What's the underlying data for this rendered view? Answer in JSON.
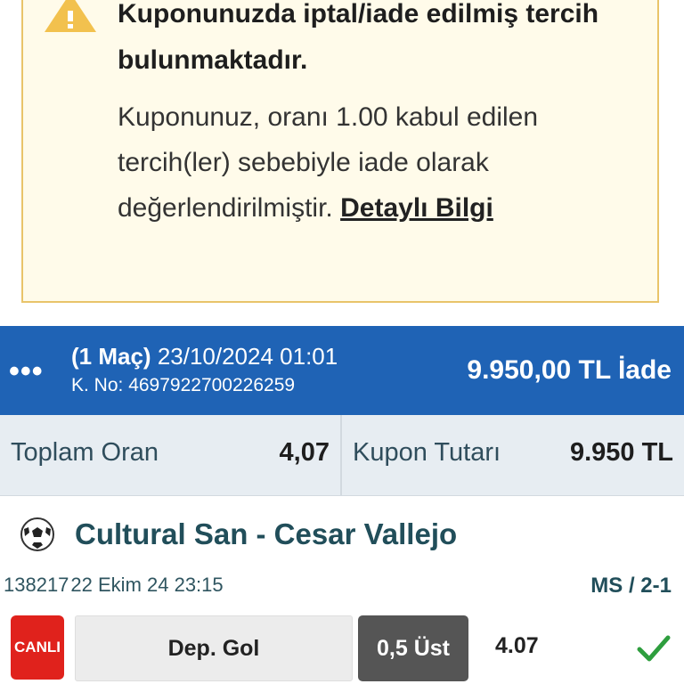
{
  "warning": {
    "title": "Kuponunuzda iptal/iade edilmiş tercih bulunmaktadır.",
    "body": "Kuponunuz, oranı 1.00 kabul edilen tercih(ler) sebebiyle iade olarak değerlendirilmiştir.",
    "link": "Detaylı Bilgi"
  },
  "coupon": {
    "menu": "•••",
    "match_count": "(1 Maç)",
    "datetime": "23/10/2024 01:01",
    "coupon_no": "K. No: 4697922700226259",
    "amount": "9.950,00 TL İade"
  },
  "summary": {
    "total_odds_label": "Toplam Oran",
    "total_odds_value": "4,07",
    "coupon_amount_label": "Kupon Tutarı",
    "coupon_amount_value": "9.950 TL"
  },
  "match": {
    "name": "Cultural San - Cesar Vallejo",
    "code": "138217",
    "date": "22 Ekim 24 23:15",
    "bet_type": "MS / 2-1",
    "live_label": "CANLI",
    "market": "Dep. Gol",
    "choice": "0,5 Üst",
    "odd": "4.07"
  },
  "colors": {
    "header_blue": "#1f63b5",
    "warning_border": "#e9c46a",
    "live_red": "#e0221c",
    "success_green": "#2e9e3e",
    "team_text": "#214e5a"
  },
  "icons": {
    "warning": "warning-triangle-icon",
    "ball": "soccer-ball-icon",
    "check": "check-icon"
  }
}
